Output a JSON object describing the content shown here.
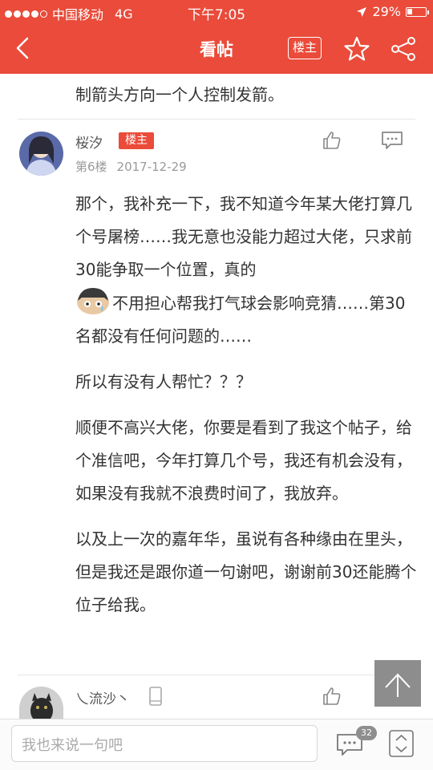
{
  "status_bar": {
    "carrier": "中国移动",
    "network": "4G",
    "time": "下午7:05",
    "battery": "29%",
    "battery_level": 0.29
  },
  "header": {
    "title": "看帖",
    "owner_button": "楼主"
  },
  "previous_post_tail": "制箭头方向一个人控制发箭。",
  "post": {
    "username": "桜汐",
    "badge": "楼主",
    "floor": "第6楼",
    "date": "2017-12-29",
    "paragraph_1": "那个，我补充一下，我不知道今年某大佬打算几个号屠榜……我无意也没能力超过大佬，只求前30能争取一个位置，真的",
    "paragraph_1b": "不用担心帮我打气球会影响竞猜……第30名都没有任何问题的……",
    "paragraph_2": "所以有没有人帮忙？？？",
    "paragraph_3": "顺便不高兴大佬，你要是看到了我这个帖子，给个准信吧，今年打算几个号，我还有机会没有，如果没有我就不浪费时间了，我放弃。",
    "paragraph_4": "以及上一次的嘉年华，虽说有各种缘由在里头，但是我还是跟你道一句谢吧，谢谢前30还能腾个位子给我。"
  },
  "next_post": {
    "username": "乀流沙丶"
  },
  "bottom_bar": {
    "input_placeholder": "我也来说一句吧",
    "comment_count": "32"
  },
  "colors": {
    "brand": "#ea4b3a",
    "muted_text": "#9a9a9a"
  },
  "icons": [
    "back-arrow-icon",
    "star-icon",
    "share-icon",
    "thumbs-up-icon",
    "reply-icon",
    "phone-icon",
    "scroll-top-icon",
    "comment-icon",
    "page-nav-icon"
  ]
}
